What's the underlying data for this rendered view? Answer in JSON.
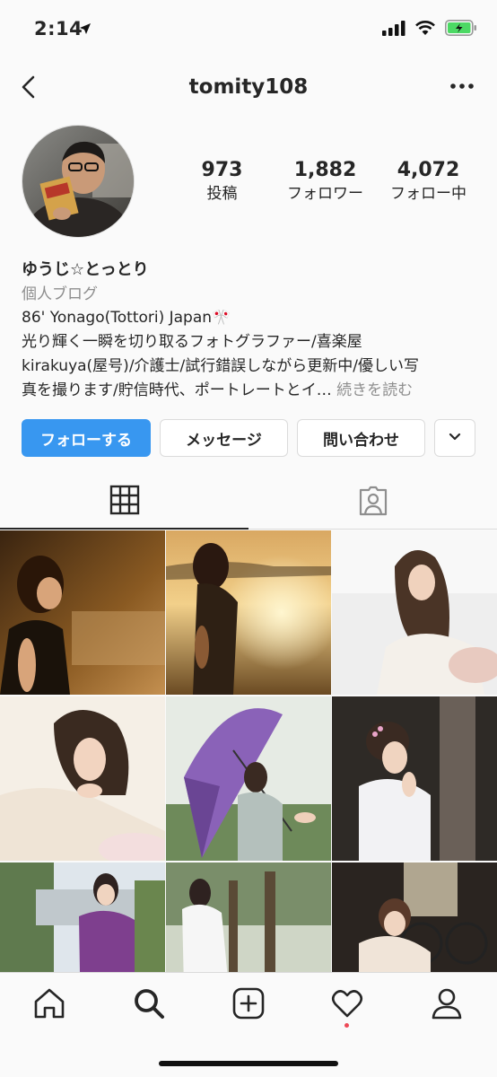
{
  "status": {
    "time": "2:14"
  },
  "nav": {
    "username": "tomity108"
  },
  "stats": [
    {
      "value": "973",
      "label": "投稿"
    },
    {
      "value": "1,882",
      "label": "フォロワー"
    },
    {
      "value": "4,072",
      "label": "フォロー中"
    }
  ],
  "bio": {
    "name": "ゆうじ☆とっとり",
    "category": "個人ブログ",
    "line1": "86' Yonago(Tottori) Japan🎌",
    "line2": "光り輝く一瞬を切り取るフォトグラファー/喜楽屋",
    "line3": "kirakuya(屋号)/介護士/試行錯誤しながら更新中/優しい写",
    "line4": "真を撮ります/貯信時代、ポートレートとイ…",
    "more": "続きを読む"
  },
  "actions": {
    "follow": "フォローする",
    "message": "メッセージ",
    "contact": "問い合わせ"
  },
  "icons": {
    "back": "chevron-left-icon",
    "more": "more-horizontal-icon",
    "grid": "grid-icon",
    "tagged": "tagged-person-icon",
    "home": "home-icon",
    "search": "search-icon",
    "new_post": "add-post-icon",
    "activity": "heart-icon",
    "profile": "profile-icon"
  },
  "colors": {
    "follow_button": "#3897f0",
    "notification_dot": "#ed4956"
  }
}
